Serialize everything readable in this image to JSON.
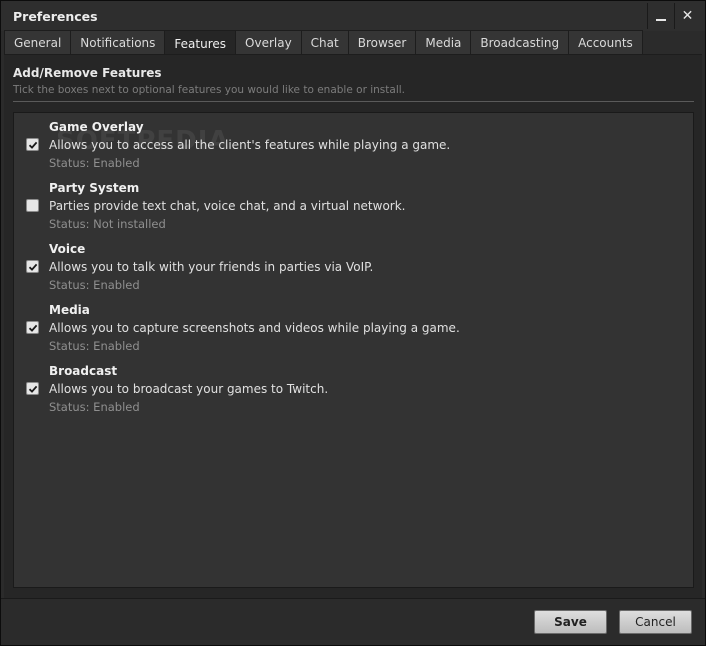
{
  "window": {
    "title": "Preferences"
  },
  "tabs": [
    {
      "label": "General"
    },
    {
      "label": "Notifications"
    },
    {
      "label": "Features",
      "active": true
    },
    {
      "label": "Overlay"
    },
    {
      "label": "Chat"
    },
    {
      "label": "Browser"
    },
    {
      "label": "Media"
    },
    {
      "label": "Broadcasting"
    },
    {
      "label": "Accounts"
    }
  ],
  "section": {
    "title": "Add/Remove Features",
    "subtitle": "Tick the boxes next to optional features you would like to enable or install."
  },
  "watermark": "SOFTPEDIA",
  "features": [
    {
      "name": "Game Overlay",
      "description": "Allows you to access all the client's features while playing a game.",
      "status": "Status: Enabled",
      "checked": true
    },
    {
      "name": "Party System",
      "description": "Parties provide text chat, voice chat, and a virtual network.",
      "status": "Status: Not installed",
      "checked": false
    },
    {
      "name": "Voice",
      "description": "Allows you to talk with your friends in parties via VoIP.",
      "status": "Status: Enabled",
      "checked": true
    },
    {
      "name": "Media",
      "description": "Allows you to capture screenshots and videos while playing a game.",
      "status": "Status: Enabled",
      "checked": true
    },
    {
      "name": "Broadcast",
      "description": "Allows you to broadcast your games to Twitch.",
      "status": "Status: Enabled",
      "checked": true
    }
  ],
  "buttons": {
    "save": "Save",
    "cancel": "Cancel"
  },
  "icons": {
    "minimize": "minimize-icon",
    "close": "close-icon",
    "check": "checkmark-icon"
  },
  "colors": {
    "background": "#2b2b2b",
    "panel": "#333333",
    "button": "#d0d0d0"
  }
}
